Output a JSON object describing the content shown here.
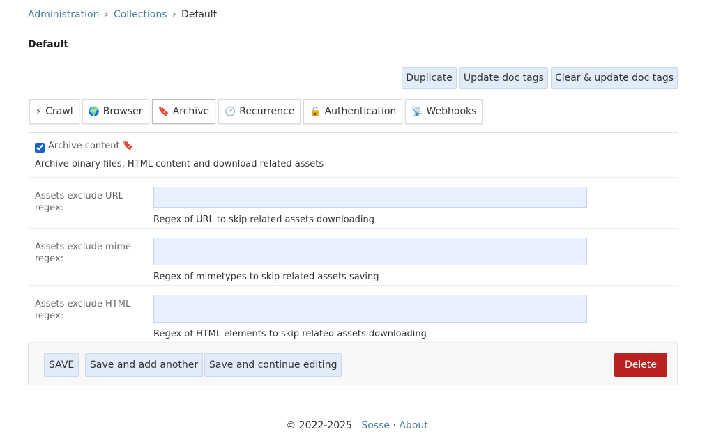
{
  "breadcrumbs": {
    "home": "Administration",
    "sep1": "›",
    "section": "Collections",
    "sep2": "›",
    "current": "Default"
  },
  "page_title": "Default",
  "tools": {
    "duplicate": "Duplicate",
    "update_tags": "Update doc tags",
    "clear_update_tags": "Clear & update doc tags"
  },
  "tabs": [
    {
      "icon": "⚡",
      "label": "Crawl"
    },
    {
      "icon": "🌍",
      "label": "Browser"
    },
    {
      "icon": "🔖",
      "label": "Archive"
    },
    {
      "icon": "🕑",
      "label": "Recurrence"
    },
    {
      "icon": "🔒",
      "label": "Authentication"
    },
    {
      "icon": "📡",
      "label": "Webhooks"
    }
  ],
  "archive": {
    "checkbox_label": "Archive content 🔖",
    "checked": true,
    "help": "Archive binary files, HTML content and download related assets"
  },
  "fields": [
    {
      "label": "Assets exclude URL regex:",
      "value": "",
      "help": "Regex of URL to skip related assets downloading"
    },
    {
      "label": "Assets exclude mime regex:",
      "value": "",
      "help": "Regex of mimetypes to skip related assets saving"
    },
    {
      "label": "Assets exclude HTML regex:",
      "value": "",
      "help": "Regex of HTML elements to skip related assets downloading"
    }
  ],
  "submit": {
    "save": "SAVE",
    "save_add": "Save and add another",
    "save_continue": "Save and continue editing",
    "delete": "Delete"
  },
  "footer": {
    "copyright": "© 2022-2025",
    "sosse": "Sosse",
    "dot": "·",
    "about": "About"
  },
  "colors": {
    "link": "#447e9b",
    "button_bg": "#e1ecf8",
    "input_bg": "#e8f0fe",
    "delete_bg": "#ba2121"
  }
}
